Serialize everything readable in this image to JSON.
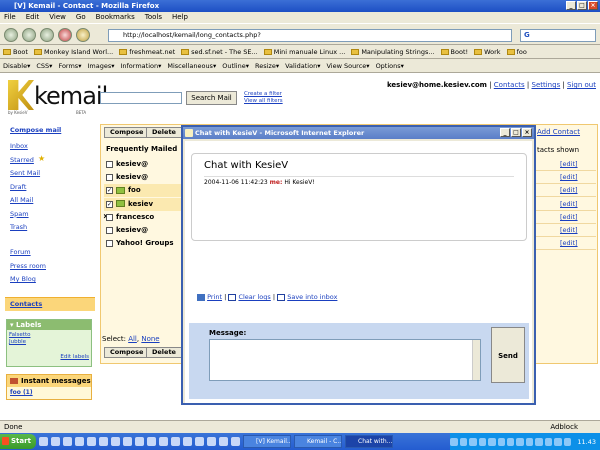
{
  "window": {
    "title": "[V] Kemail - Contact - Mozilla Firefox"
  },
  "menu": [
    "File",
    "Edit",
    "View",
    "Go",
    "Bookmarks",
    "Tools",
    "Help"
  ],
  "nav": {
    "url": "http://localhost/kemail/long_contacts.php?",
    "search_value": "G"
  },
  "bookmarks": [
    "Boot",
    "Monkey Island Worl...",
    "freshmeat.net",
    "sed.sf.net - The SE...",
    "Mini manuale Linux ...",
    "Manipulating Strings...",
    "Boot!",
    "Work",
    "foo"
  ],
  "webdev": [
    "Disable",
    "CSS",
    "Forms",
    "Images",
    "Information",
    "Miscellaneous",
    "Outline",
    "Resize",
    "Validation",
    "View Source",
    "Options"
  ],
  "kemail": {
    "logo": "kemail",
    "logo_sub": "by KesieV",
    "beta": "BETA",
    "search_btn": "Search Mail",
    "create_filter": "Create a filter",
    "view_filters": "View all filters",
    "user": "kesiev@home.kesiev.com",
    "top_links": [
      "Contacts",
      "Settings",
      "Sign out"
    ]
  },
  "sidebar": {
    "compose": "Compose mail",
    "items": [
      "Inbox",
      "Starred",
      "Sent Mail",
      "Draft",
      "All Mail",
      "Spam",
      "Trash"
    ],
    "items2": [
      "Forum",
      "Press room",
      "My Blog"
    ],
    "contacts": "Contacts",
    "labels_title": "Labels",
    "labels": [
      "Falsetto",
      "Jubble"
    ],
    "edit_labels": "Edit labels",
    "im_title": "Instant messages",
    "im_item": "foo (1)"
  },
  "contacts": {
    "compose_btn": "Compose",
    "delete_btn": "Delete",
    "header": "Frequently Mailed",
    "add_contact": "Add Contact",
    "shown": "tacts shown",
    "rows": [
      {
        "name": "kesiev@",
        "checked": false,
        "icon": false
      },
      {
        "name": "kesiev@",
        "checked": false,
        "icon": false
      },
      {
        "name": "foo",
        "checked": true,
        "icon": true
      },
      {
        "name": "kesiev",
        "checked": true,
        "icon": true
      },
      {
        "name": "francesco",
        "checked": false,
        "icon": false
      },
      {
        "name": "kesiev@",
        "checked": false,
        "icon": false
      },
      {
        "name": "Yahoo! Groups",
        "checked": false,
        "icon": false
      }
    ],
    "edit": "[edit]",
    "select_label": "Select:",
    "select_all": "All",
    "select_none": "None"
  },
  "chat": {
    "title": "Chat with KesieV - Microsoft Internet Explorer",
    "heading": "Chat with KesieV",
    "time": "2004-11-06 11:42:23",
    "who": "me:",
    "text": "Hi KesieV!",
    "print": "Print",
    "clear": "Clear logs",
    "save": "Save into inbox",
    "message_label": "Message:",
    "send": "Send"
  },
  "status": {
    "left": "Done",
    "right": "Adblock"
  },
  "taskbar": {
    "start": "Start",
    "tasks": [
      "[V] Kemail...",
      "Kemail - C...",
      "Chat with..."
    ],
    "clock": "11.43"
  }
}
